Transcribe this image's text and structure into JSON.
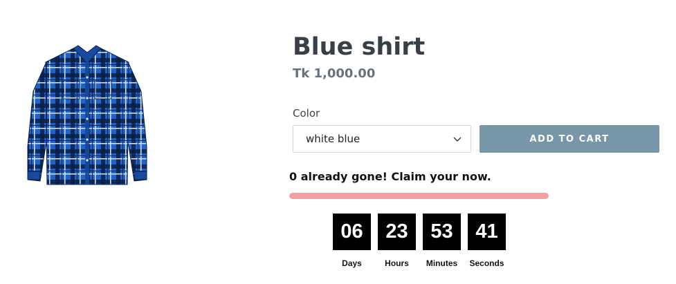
{
  "product": {
    "title": "Blue shirt",
    "price": "Tk 1,000.00",
    "image_icon": "plaid-shirt-image"
  },
  "variant": {
    "label": "Color",
    "selected": "white blue"
  },
  "cart": {
    "add_label": "ADD TO CART"
  },
  "urgency": {
    "message": "0 already gone! Claim your now.",
    "progress_fraction": 1.0
  },
  "countdown": {
    "days": {
      "value": "06",
      "label": "Days"
    },
    "hours": {
      "value": "23",
      "label": "Hours"
    },
    "minutes": {
      "value": "53",
      "label": "Minutes"
    },
    "seconds": {
      "value": "41",
      "label": "Seconds"
    }
  },
  "colors": {
    "button": "#7796a8",
    "progress_fill": "#f4a0a0",
    "shirt_blue": "#1f63c8",
    "shirt_dark": "#0b1f46"
  }
}
